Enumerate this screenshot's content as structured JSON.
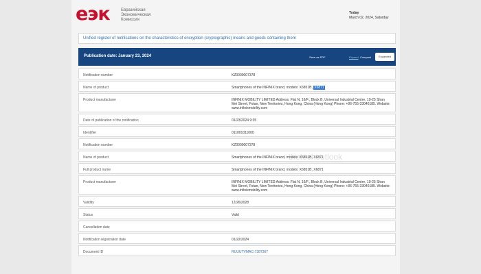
{
  "header": {
    "logo": "еэк",
    "org_lines": [
      "Евразийская",
      "Экономическая",
      "Комиссия"
    ],
    "today_label": "Today",
    "today_date": "March 02, 2024, Saturday"
  },
  "page_title": "Unified register of notifications on the characteristics of encryption (cryptographic) means and goods containing them",
  "toolbar": {
    "publication_date": "Publication date: January 23, 2024",
    "save_pdf": "Save as PDF",
    "link": "Expand",
    "compact": "Compact",
    "expanded": "Expanded"
  },
  "rows": [
    {
      "label": "Notification number",
      "value": "KZ0000007378",
      "h": 16
    },
    {
      "label": "Name of product",
      "value_pre": "Smartphones of the INFINIX brand, models: X6851B, ",
      "value_hl": "X6871",
      "h": 16
    },
    {
      "label": "Product manufacturer",
      "value": "INFINIX MOBILITY LIMITED Address: Flat N, 16/F., Block B, Universal Industrial Centre, 19-25 Shan Mei Street, Fotan, New Territories, Hong Kong, China (Hong Kong) Phone: +86-755-33040185. Website: www.infinixmobility.com",
      "h": 28
    },
    {
      "label": "Date of publication of the notification",
      "value": "01/23/2024 9:35",
      "h": 16
    },
    {
      "label": "Identifier",
      "value": "011001011000",
      "h": 16
    },
    {
      "label": "Notification number",
      "value": "KZ0000007378",
      "h": 16
    },
    {
      "label": "Name of product",
      "value": "Smartphones of the INFINIX brand, models: X6851B, X6871",
      "h": 16
    },
    {
      "label": "Full product name",
      "value": "Smartphones of the INFINIX brand, models: X6851B, X6871",
      "h": 16
    },
    {
      "label": "Product manufacturer",
      "value": "INFINIX MOBILITY LIMITED Address: Flat N, 16/F., Block B, Universal Industrial Centre, 19-25 Shan Mei Street, Fotan, New Territories, Hong Kong, China (Hong Kong) Phone: +86-755-33040185. Website: www.infinixmobility.com",
      "h": 28
    },
    {
      "label": "Validity",
      "value": "12/26/2028",
      "h": 16
    },
    {
      "label": "Status",
      "value": "Valid",
      "h": 16
    },
    {
      "label": "Cancellation date",
      "value": "",
      "h": 16
    },
    {
      "label": "Notification registration date",
      "value": "01/22/2024",
      "h": 16
    },
    {
      "label": "Document ID",
      "value": "RUUUTVMAC-7387367",
      "link": true,
      "h": 16
    }
  ],
  "watermark": "thetechoutlook",
  "colors": {
    "brand_red": "#c8102e",
    "bar_blue": "#17457f",
    "link_blue": "#2f6fb0"
  }
}
